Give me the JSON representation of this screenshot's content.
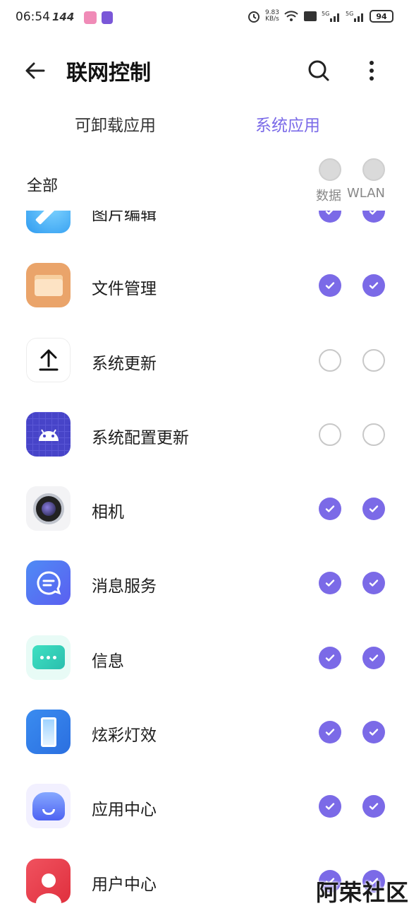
{
  "status_bar": {
    "time": "06:54",
    "refresh_rate": "144",
    "net_speed_value": "9.83",
    "net_speed_unit": "KB/s",
    "battery": "94",
    "network": "5G"
  },
  "header": {
    "title": "联网控制",
    "back_icon": "arrow-left-icon",
    "search_icon": "search-icon",
    "more_icon": "more-vertical-icon"
  },
  "tabs": [
    {
      "label": "可卸载应用",
      "active": false
    },
    {
      "label": "系统应用",
      "active": true
    }
  ],
  "section": {
    "label": "全部",
    "columns": [
      "数据",
      "WLAN"
    ]
  },
  "apps": [
    {
      "name": "图片编辑",
      "icon": "photo-edit-icon",
      "data": true,
      "wlan": true
    },
    {
      "name": "文件管理",
      "icon": "folder-icon",
      "data": true,
      "wlan": true
    },
    {
      "name": "系统更新",
      "icon": "upload-icon",
      "data": false,
      "wlan": false
    },
    {
      "name": "系统配置更新",
      "icon": "android-icon",
      "data": false,
      "wlan": false
    },
    {
      "name": "相机",
      "icon": "camera-icon",
      "data": true,
      "wlan": true
    },
    {
      "name": "消息服务",
      "icon": "message-service-icon",
      "data": true,
      "wlan": true
    },
    {
      "name": "信息",
      "icon": "sms-icon",
      "data": true,
      "wlan": true
    },
    {
      "name": "炫彩灯效",
      "icon": "light-effect-icon",
      "data": true,
      "wlan": true
    },
    {
      "name": "应用中心",
      "icon": "app-store-icon",
      "data": true,
      "wlan": true
    },
    {
      "name": "用户中心",
      "icon": "user-center-icon",
      "data": true,
      "wlan": true
    }
  ],
  "watermark": "阿荣社区",
  "colors": {
    "accent": "#7b6ae7",
    "unchecked_border": "#c8c8c8"
  }
}
